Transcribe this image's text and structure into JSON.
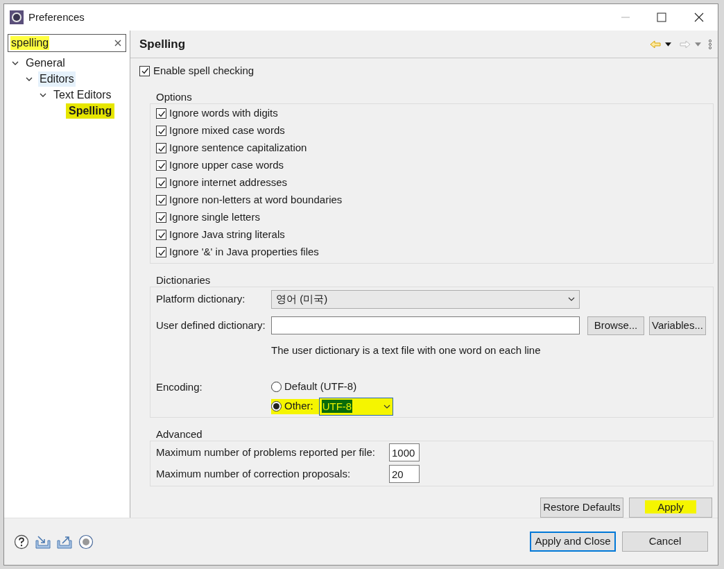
{
  "window": {
    "title": "Preferences"
  },
  "filter": {
    "value": "spelling"
  },
  "tree": [
    {
      "label": "General",
      "expanded": true,
      "selected": false,
      "children": [
        {
          "label": "Editors",
          "expanded": true,
          "selected": false,
          "children": [
            {
              "label": "Text Editors",
              "expanded": true,
              "selected": false,
              "children": [
                {
                  "label": "Spelling",
                  "selected": true
                }
              ]
            }
          ]
        }
      ]
    }
  ],
  "page": {
    "title": "Spelling"
  },
  "enable": {
    "label": "Enable spell checking",
    "checked": true
  },
  "options": {
    "title": "Options",
    "items": [
      {
        "label": "Ignore words with digits",
        "checked": true
      },
      {
        "label": "Ignore mixed case words",
        "checked": true
      },
      {
        "label": "Ignore sentence capitalization",
        "checked": true
      },
      {
        "label": "Ignore upper case words",
        "checked": true
      },
      {
        "label": "Ignore internet addresses",
        "checked": true
      },
      {
        "label": "Ignore non-letters at word boundaries",
        "checked": true
      },
      {
        "label": "Ignore single letters",
        "checked": true
      },
      {
        "label": "Ignore Java string literals",
        "checked": true
      },
      {
        "label": "Ignore '&' in Java properties files",
        "checked": true
      }
    ]
  },
  "dictionaries": {
    "title": "Dictionaries",
    "platform_label": "Platform dictionary:",
    "platform_value": "영어 (미국)",
    "user_label": "User defined dictionary:",
    "browse": "Browse...",
    "variables": "Variables...",
    "note": "The user dictionary is a text file with one word on each line",
    "encoding_label": "Encoding:",
    "encodings": [
      {
        "label": "Default (UTF-8)",
        "selected": false
      },
      {
        "label": "Other:",
        "selected": true,
        "value": "UTF-8"
      }
    ]
  },
  "advanced": {
    "title": "Advanced",
    "fields": [
      {
        "label": "Maximum number of problems reported per file:",
        "value": "1000"
      },
      {
        "label": "Maximum number of correction proposals:",
        "value": "20"
      }
    ]
  },
  "page_buttons": [
    "Restore Defaults",
    "Apply"
  ],
  "dialog_buttons": [
    {
      "label": "Apply and Close",
      "default": true
    },
    {
      "label": "Cancel",
      "default": false
    }
  ]
}
